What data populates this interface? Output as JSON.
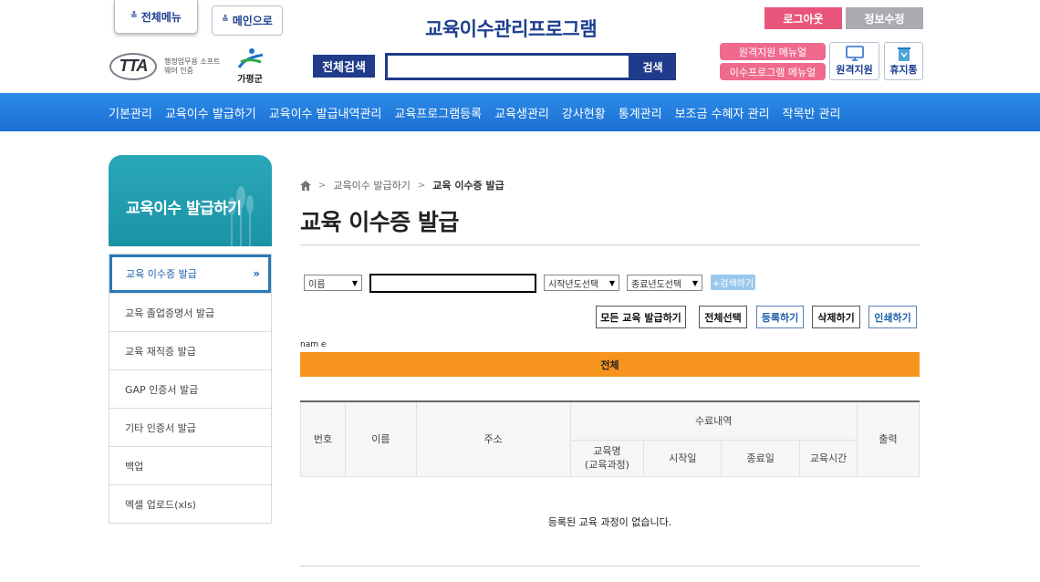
{
  "header": {
    "all_menu": "전체메뉴",
    "main_link": "메인으로",
    "site_title": "교육이수관리프로그램",
    "tta_logo": "TTA",
    "tta_text": "행정업무용 소프트웨어 인증",
    "county_name": "가평군",
    "search_label": "전체검색",
    "search_button": "검색",
    "logout": "로그아웃",
    "profile": "정보수정",
    "manual_remote": "원격지원 메뉴얼",
    "manual_program": "이수프로그램 메뉴얼",
    "remote_support": "원격지원",
    "trash": "휴지통"
  },
  "nav": {
    "items": [
      "기본관리",
      "교육이수 발급하기",
      "교육이수 발급내역관리",
      "교육프로그램등록",
      "교육생관리",
      "강사현황",
      "통계관리",
      "보조금 수혜자 관리",
      "작목반 관리"
    ]
  },
  "sidebar": {
    "title": "교육이수 발급하기",
    "items": [
      "교육 이수증 발급",
      "교육 졸업증명서 발급",
      "교육 재직증 발급",
      "GAP 인증서 발급",
      "기타 인증서 발급",
      "백업",
      "엑셀 업로드(xls)"
    ],
    "active_arrow": "»"
  },
  "breadcrumb": {
    "parent": "교육이수 발급하기",
    "current": "교육 이수증 발급"
  },
  "page_title": "교육 이수증 발급",
  "filters": {
    "field_select": "이름",
    "start_year": "시작년도선택",
    "end_year": "종료년도선택",
    "search": "+검색하기"
  },
  "actions": {
    "issue_all": "모든 교육 발급하기",
    "select_all": "전체선택",
    "register": "등록하기",
    "delete": "삭제하기",
    "print": "인쇄하기"
  },
  "name_tag": "nam e",
  "category_bar": "전체",
  "table": {
    "headers": {
      "no": "번호",
      "name": "이름",
      "address": "주소",
      "completion": "수료내역",
      "output": "출력",
      "course": "교육명\n(교육과정)",
      "start": "시작일",
      "end": "종료일",
      "hours": "교육시간"
    },
    "empty_message": "등록된 교육 과정이 없습니다."
  },
  "colors": {
    "nav": "#1b6fd2",
    "brand_navy": "#1f3b8a",
    "sidebar_head": "#1a93a5",
    "logout": "#e9557a",
    "orange_bar": "#f7941d"
  }
}
